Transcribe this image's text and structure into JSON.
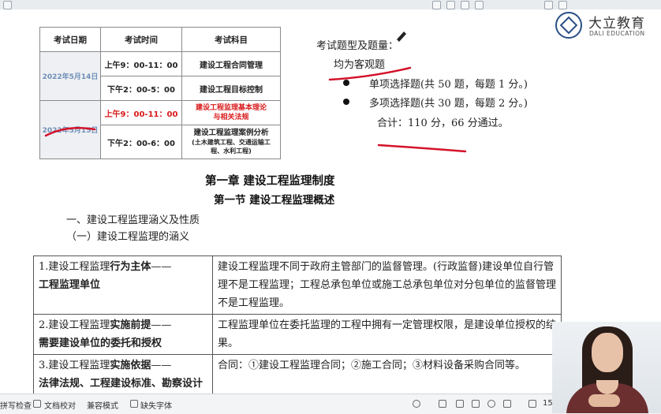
{
  "exam_table": {
    "headers": [
      "考试日期",
      "考试时间",
      "考试科目"
    ],
    "day1": {
      "date": "2022年5月14日",
      "sessions": [
        {
          "time": "上午9：00-11：00",
          "subject": "建设工程合同管理"
        },
        {
          "time": "下午2：00-5：00",
          "subject": "建设工程目标控制"
        }
      ]
    },
    "day2": {
      "date": "2022年5月15日",
      "sessions": [
        {
          "time": "上午9：00-11：00",
          "subject_line1": "建设工程监理基本理论",
          "subject_line2": "与相关法规"
        },
        {
          "time": "下午2：00-6：00",
          "subject_line1": "建设工程监理案例分析",
          "subject_line2": "(土木建筑工程、交通运输工",
          "subject_line3": "程、水利工程)"
        }
      ]
    }
  },
  "exam_info": {
    "title": "考试题型及题量：",
    "subtitle": "均为客观题",
    "items": [
      "单项选择题(共 50 题，每题 1 分。)",
      "多项选择题(共 30 题，每题 2 分。)"
    ],
    "total": "合计：110 分，66 分通过。"
  },
  "logo": {
    "cn": "大立教育",
    "en": "DALI EDUCATION"
  },
  "chapter": {
    "title": "第一章   建设工程监理制度",
    "section": "第一节     建设工程监理概述",
    "h1": "一、建设工程监理涵义及性质",
    "h2": "（一）建设工程监理的涵义"
  },
  "concept_table": {
    "rows": [
      {
        "left_prefix": "1.建设工程监理",
        "left_bold": "行为主体",
        "left_dash": "——",
        "left_line2": "工程监理单位",
        "right": "建设工程监理不同于政府主管部门的监督管理。(行政监督)建设单位自行管理不是工程监理；工程总承包单位或施工总承包单位对分包单位的监督管理不是工程监理。"
      },
      {
        "left_prefix": "2.建设工程监理",
        "left_bold": "实施前提",
        "left_dash": "——",
        "left_line2": "需要建设单位的委托和授权",
        "right": "工程监理单位在委托监理的工程中拥有一定管理权限，是建设单位授权的结果。"
      },
      {
        "left_prefix": "3.建设工程监理",
        "left_bold": "实施依据",
        "left_dash": "——",
        "left_line2": "法律法规、工程建设标准、勘察设计文件及合同",
        "right": "合同：①建设工程监理合同；②施工合同；③材料设备采购合同等。"
      }
    ]
  },
  "statusbar": {
    "check": "拼写检查",
    "proofread": "文档校对",
    "compat": "兼容模式",
    "missing_font": "缺失字体",
    "zoom": "15"
  },
  "colors": {
    "red": "#d91a1a",
    "date_blue": "#6f8fb8",
    "annotation_red": "#d4122a",
    "brand_blue": "#2a4f86"
  }
}
